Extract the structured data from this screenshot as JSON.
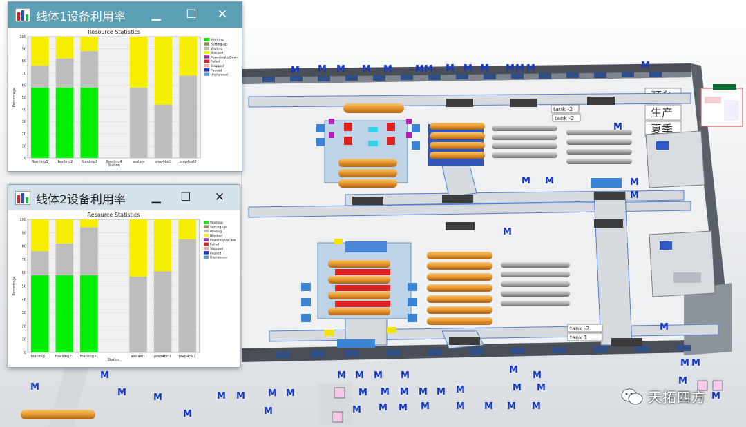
{
  "scene": {
    "wall_signs": [
      "预备",
      "生产",
      "夏季"
    ],
    "machine_marker": "M",
    "tank_labels": [
      "tank -2",
      "tank -2",
      "tank -2",
      "tank 1"
    ]
  },
  "windows": [
    {
      "title": "线体1设备利用率",
      "minimize_icon": "minimize-icon",
      "maximize_icon": "maximize-icon",
      "close_icon": "close-icon",
      "chart_data": {
        "type": "bar",
        "stacked": true,
        "title": "Resource Statistics",
        "xlabel": "Station",
        "ylabel": "Percentage",
        "ylim": [
          0,
          100
        ],
        "yticks": [
          0,
          10,
          20,
          30,
          40,
          50,
          60,
          70,
          80,
          90,
          100
        ],
        "categories": [
          "fbanling1",
          "fbanling2",
          "fbanling3",
          "fbanling4",
          "asslam",
          "prep4bcl1",
          "prep4cal2"
        ],
        "series": [
          {
            "name": "Working",
            "color": "#00ee00",
            "values": [
              58,
              58,
              58,
              0,
              0,
              0,
              0
            ]
          },
          {
            "name": "Setting-up",
            "color": "#9b8a5e",
            "values": [
              0,
              0,
              0,
              0,
              0,
              0,
              0
            ]
          },
          {
            "name": "Waiting",
            "color": "#bdbdbd",
            "values": [
              18,
              24,
              30,
              0,
              58,
              44,
              68
            ]
          },
          {
            "name": "Blocked",
            "color": "#f5ee00",
            "values": [
              24,
              18,
              12,
              0,
              42,
              56,
              32
            ]
          },
          {
            "name": "PoweringUpDown",
            "color": "#9a2fb0",
            "values": [
              0,
              0,
              0,
              0,
              0,
              0,
              0
            ]
          },
          {
            "name": "Failed",
            "color": "#e12222",
            "values": [
              0,
              0,
              0,
              0,
              0,
              0,
              0
            ]
          },
          {
            "name": "Stopped",
            "color": "#f2a5a5",
            "values": [
              0,
              0,
              0,
              0,
              0,
              0,
              0
            ]
          },
          {
            "name": "Paused",
            "color": "#1a2fd6",
            "values": [
              0,
              0,
              0,
              0,
              0,
              0,
              0
            ]
          },
          {
            "name": "Unplanned",
            "color": "#5aa0d8",
            "values": [
              0,
              0,
              0,
              0,
              0,
              0,
              0
            ]
          }
        ],
        "legend_placement": "right",
        "grid": true
      }
    },
    {
      "title": "线体2设备利用率",
      "minimize_icon": "minimize-icon",
      "maximize_icon": "maximize-icon",
      "close_icon": "close-icon",
      "chart_data": {
        "type": "bar",
        "stacked": true,
        "title": "Resource Statistics",
        "xlabel": "Station",
        "ylabel": "Percentage",
        "ylim": [
          0,
          100
        ],
        "yticks": [
          0,
          10,
          20,
          30,
          40,
          50,
          60,
          70,
          80,
          90,
          100
        ],
        "categories": [
          "fbanling11",
          "fbanling21",
          "fbanling31",
          "",
          "asslam1",
          "prep4bcl1",
          "prep4cal2"
        ],
        "series": [
          {
            "name": "Working",
            "color": "#00ee00",
            "values": [
              58,
              58,
              58,
              0,
              0,
              0,
              0
            ]
          },
          {
            "name": "Setting-up",
            "color": "#9b8a5e",
            "values": [
              0,
              0,
              0,
              0,
              0,
              0,
              0
            ]
          },
          {
            "name": "Waiting",
            "color": "#bdbdbd",
            "values": [
              18,
              24,
              36,
              0,
              57,
              61,
              85
            ]
          },
          {
            "name": "Blocked",
            "color": "#f5ee00",
            "values": [
              24,
              18,
              6,
              0,
              43,
              39,
              15
            ]
          },
          {
            "name": "PoweringUpDown",
            "color": "#9a2fb0",
            "values": [
              0,
              0,
              0,
              0,
              0,
              0,
              0
            ]
          },
          {
            "name": "Failed",
            "color": "#e12222",
            "values": [
              0,
              0,
              0,
              0,
              0,
              0,
              0
            ]
          },
          {
            "name": "Stopped",
            "color": "#f2a5a5",
            "values": [
              0,
              0,
              0,
              0,
              0,
              0,
              0
            ]
          },
          {
            "name": "Paused",
            "color": "#1a2fd6",
            "values": [
              0,
              0,
              0,
              0,
              0,
              0,
              0
            ]
          },
          {
            "name": "Unplanned",
            "color": "#5aa0d8",
            "values": [
              0,
              0,
              0,
              0,
              0,
              0,
              0
            ]
          }
        ],
        "legend_placement": "right",
        "grid": true
      }
    }
  ],
  "brand": {
    "name": "天拓四方",
    "logo_icon": "wechat-icon"
  }
}
